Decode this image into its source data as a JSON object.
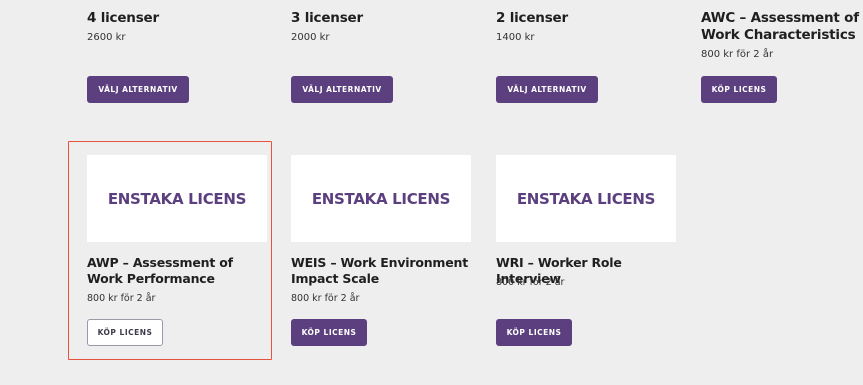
{
  "top_cards": [
    {
      "title": "4 licenser",
      "price": "2600 kr",
      "button": "VÄLJ ALTERNATIV"
    },
    {
      "title": "3 licenser",
      "price": "2000 kr",
      "button": "VÄLJ ALTERNATIV"
    },
    {
      "title": "2 licenser",
      "price": "1400 kr",
      "button": "VÄLJ ALTERNATIV"
    },
    {
      "title": "AWC – Assessment of Work Characteristics",
      "price": "800 kr för 2 år",
      "button": "KÖP LICENS"
    }
  ],
  "bottom_cards": [
    {
      "image_text": "ENSTAKA LICENS",
      "title": "AWP – Assessment of Work Performance",
      "price": "800 kr för 2 år",
      "button": "KÖP LICENS",
      "highlighted": true
    },
    {
      "image_text": "ENSTAKA LICENS",
      "title": "WEIS – Work Environment Impact Scale",
      "price": "800 kr för 2 år",
      "button": "KÖP LICENS",
      "highlighted": false
    },
    {
      "image_text": "ENSTAKA LICENS",
      "title": "WRI – Worker Role Interview",
      "price": "800 kr för 2 år",
      "button": "KÖP LICENS",
      "highlighted": false
    }
  ],
  "colors": {
    "primary": "#5b3f7e",
    "highlight": "#e5533d",
    "background": "#efeeef"
  }
}
